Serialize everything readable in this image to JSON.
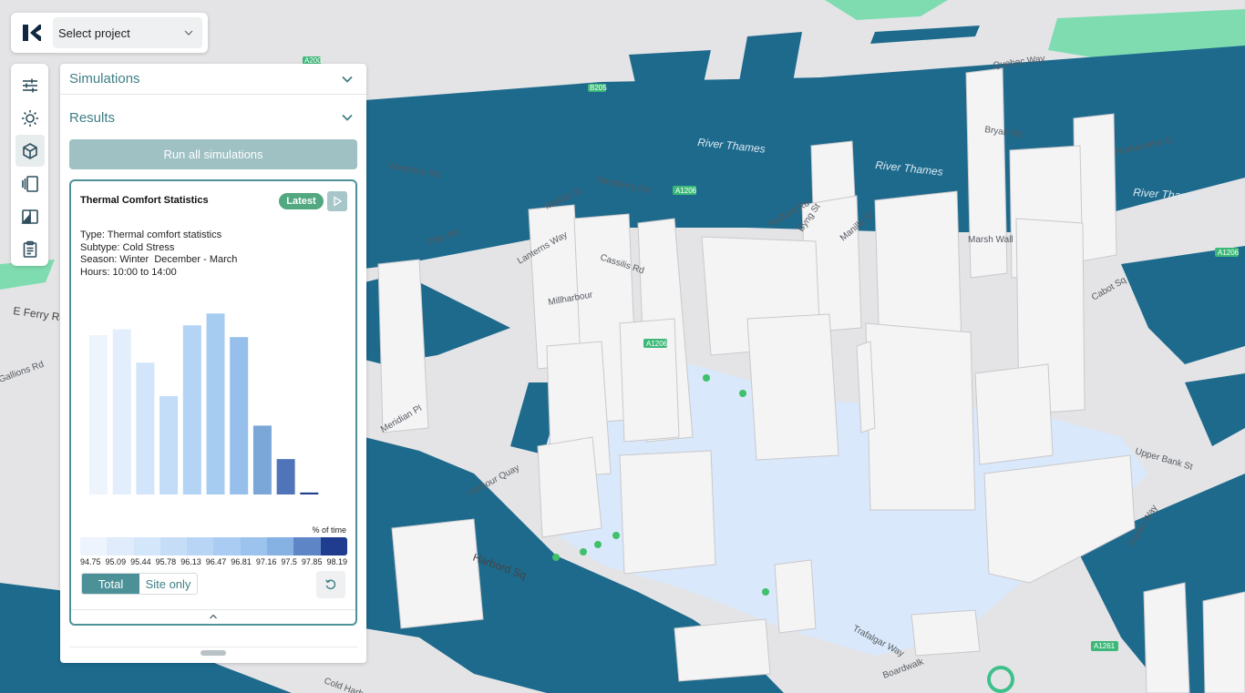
{
  "app": {
    "logo_icon": "brand-logo-icon"
  },
  "project": {
    "label": "Select project"
  },
  "rail": {
    "items": [
      {
        "icon": "sliders-icon",
        "active": false
      },
      {
        "icon": "sun-icon",
        "active": false
      },
      {
        "icon": "cube-icon",
        "active": true
      },
      {
        "icon": "layers-icon",
        "active": false
      },
      {
        "icon": "compare-icon",
        "active": false
      },
      {
        "icon": "clipboard-icon",
        "active": false
      }
    ]
  },
  "panel": {
    "simulations_label": "Simulations",
    "results_label": "Results",
    "run_button": "Run all simulations"
  },
  "card": {
    "title": "Thermal Comfort Statistics",
    "badge": "Latest",
    "type_line": "Type: Thermal comfort statistics",
    "subtype_line": "Subtype: Cold Stress",
    "season_line": "Season: Winter  December - March",
    "hours_line": "Hours: 10:00 to 14:00",
    "unit_label": "% of time",
    "toggle_total": "Total",
    "toggle_site": "Site only"
  },
  "chart_data": {
    "type": "bar",
    "values": [
      81,
      84,
      67,
      50,
      86,
      92,
      80,
      35,
      18,
      1
    ],
    "ylim": [
      0,
      100
    ],
    "colors": [
      "#eef4fc",
      "#e2eefb",
      "#d2e5fa",
      "#c3dcf7",
      "#b3d4f5",
      "#a7ccf2",
      "#96bfec",
      "#7aa6d8",
      "#4f74b9",
      "#203f8f"
    ]
  },
  "legend": {
    "colors": [
      "#edf4fd",
      "#e0ecfb",
      "#d4e6fa",
      "#c6ddf7",
      "#b8d5f5",
      "#aaccf2",
      "#9cc2ee",
      "#86b1e3",
      "#5e86c7",
      "#1f3c8e"
    ],
    "ticks": [
      "94.75",
      "95.09",
      "95.44",
      "95.78",
      "96.13",
      "96.47",
      "96.81",
      "97.16",
      "97.5",
      "97.85",
      "98.19"
    ]
  },
  "map": {
    "labels": [
      "River Thames",
      "River Thames",
      "River Thames",
      "Westferry Rd",
      "Westferry Rd",
      "E Ferry Rd",
      "Marsh Wall",
      "Harbord Sq",
      "Aspen Way",
      "Upper Bank St",
      "Trafalgar Way",
      "Boardwalk",
      "Mellish St",
      "Millharbour",
      "Cassilis Rd",
      "Manilla St",
      "Cabot Sq",
      "Harbour Quay",
      "Cold Harbour",
      "Bryan Rd",
      "Rotherhithe St",
      "Lanterns Way",
      "Tiller Rd",
      "Stafford Rd",
      "Byng St",
      "Quebec Way",
      "Meridian Pl",
      "Gallions Rd"
    ],
    "road_badges": [
      "A1206",
      "A1206",
      "A1206",
      "A1261",
      "A200",
      "B205"
    ]
  }
}
